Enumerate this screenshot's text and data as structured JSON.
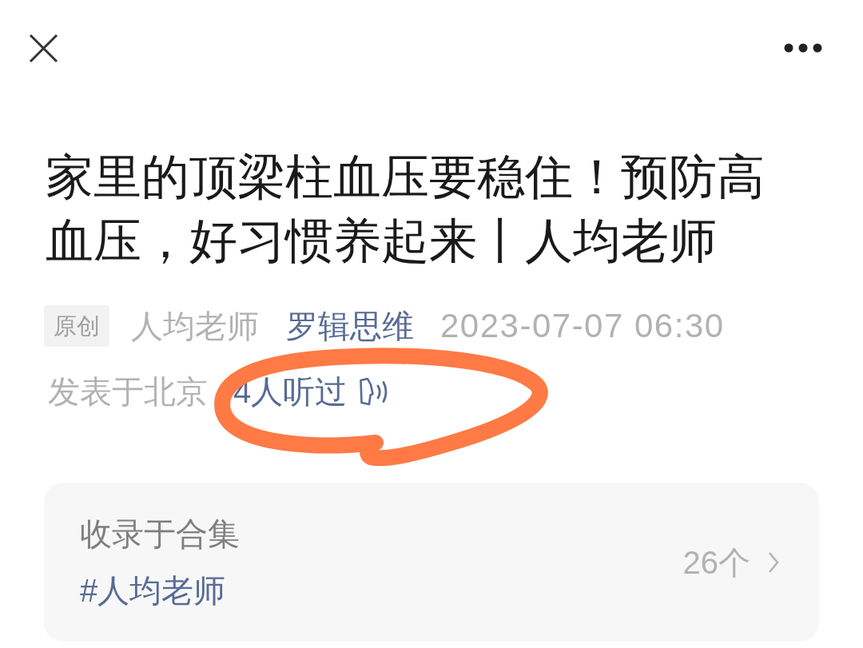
{
  "article": {
    "title": "家里的顶梁柱血压要稳住！预防高血压，好习惯养起来丨人均老师",
    "badge": "原创",
    "author": "人均老师",
    "account": "罗辑思维",
    "datetime": "2023-07-07 06:30",
    "location": "发表于北京",
    "listens": "4人听过"
  },
  "collection": {
    "label": "收录于合集",
    "tag": "#人均老师",
    "count": "26个"
  },
  "annotation": {
    "kind": "loop"
  }
}
